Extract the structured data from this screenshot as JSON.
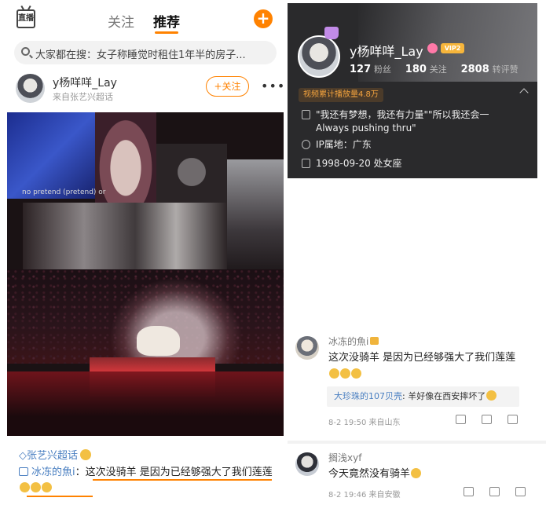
{
  "feed": {
    "topbar": {
      "live_label": "直播",
      "tabs": [
        "关注",
        "推荐"
      ],
      "active_tab": "推荐",
      "accent_color": "#ff8200"
    },
    "search": {
      "placeholder": "大家都在搜：女子称睡觉时租住1年半的房子..."
    },
    "post": {
      "user_name": "y杨咩咩_Lay",
      "source": "来自张艺兴超话",
      "follow_label": "+关注",
      "photo_caption": "no pretend (pretend) or",
      "topic": "张艺兴超话",
      "comment_user": "冰冻的魚i",
      "comment_text": "这次没骑羊 是因为已经够强大了我们莲莲"
    }
  },
  "profile": {
    "name": "y杨咩咩_Lay",
    "vip_badge": "VIP2",
    "stats": [
      {
        "value": "127",
        "label": "粉丝"
      },
      {
        "value": "180",
        "label": "关注"
      },
      {
        "value": "2808",
        "label": "转评赞"
      }
    ],
    "views_badge": "视频累计播放量4.8万",
    "bio": "\"我还有梦想，我还有力量\"\"所以我还会一Always pushing thru\"",
    "ip": "IP属地：广东",
    "birthday": "1998-09-20 处女座"
  },
  "comments": [
    {
      "user": "冰冻的魚i",
      "text": "这次没骑羊 是因为已经够强大了我们莲莲",
      "reply_user": "大珍珠的107贝壳",
      "reply_text": "羊好像在西安摔坏了",
      "meta": "8-2 19:50  来自山东"
    },
    {
      "user": "搁浅xyf",
      "text": "今天竟然没有骑羊",
      "meta": "8-2 19:46  来自安徽"
    }
  ]
}
